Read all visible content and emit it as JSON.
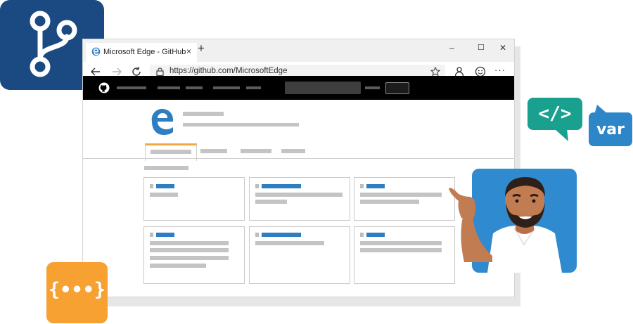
{
  "browser": {
    "tab_title": "Microsoft Edge - GitHub",
    "tab_close": "×",
    "new_tab": "+",
    "url": "https://github.com/MicrosoftEdge",
    "window_controls": {
      "minimize": "–",
      "maximize": "☐",
      "close": "✕"
    },
    "menu": "···"
  },
  "bubbles": {
    "code": "</>",
    "var": "var",
    "json": "{•••}"
  },
  "colors": {
    "git_tile": "#1b4a82",
    "code_bubble": "#19a08f",
    "var_bubble": "#2d86c8",
    "json_tile": "#f7a133",
    "person_tile": "#2f8ad0",
    "active_tab_accent": "#f2a93b",
    "link_placeholder": "#2d7fc1"
  }
}
